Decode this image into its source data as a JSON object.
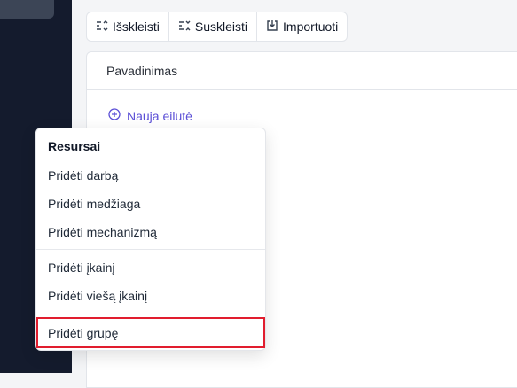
{
  "toolbar": {
    "expand_label": "Išskleisti",
    "collapse_label": "Suskleisti",
    "import_label": "Importuoti"
  },
  "table": {
    "column_name": "Pavadinimas",
    "new_row_label": "Nauja eilutė"
  },
  "menu": {
    "heading": "Resursai",
    "items": [
      "Pridėti darbą",
      "Pridėti medžiaga",
      "Pridėti mechanizmą",
      "Pridėti įkainį",
      "Pridėti viešą įkainį",
      "Pridėti grupę"
    ]
  },
  "colors": {
    "accent": "#5b4fd6",
    "highlight": "#e11d2e",
    "sidebar": "#141b2d"
  },
  "icons": [
    "expand-icon",
    "collapse-icon",
    "import-icon",
    "plus-circle-icon"
  ]
}
